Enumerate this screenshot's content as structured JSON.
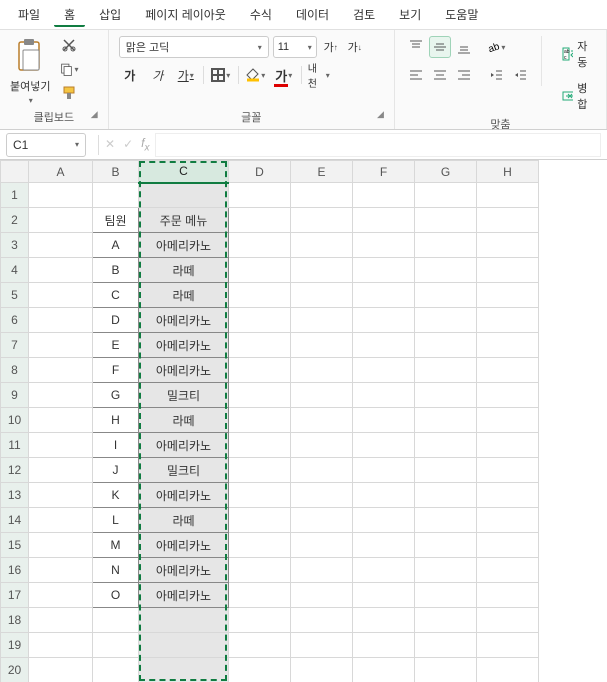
{
  "menu": {
    "items": [
      "파일",
      "홈",
      "삽입",
      "페이지 레이아웃",
      "수식",
      "데이터",
      "검토",
      "보기",
      "도움말"
    ],
    "active_index": 1
  },
  "ribbon": {
    "clipboard": {
      "paste_label": "붙여넣기",
      "group_label": "클립보드"
    },
    "font": {
      "name": "맑은 고딕",
      "size": "11",
      "group_label": "글꼴",
      "bold": "가",
      "italic": "가",
      "underline": "가",
      "grow": "가",
      "shrink": "가"
    },
    "align": {
      "group_label": "맞춤",
      "vert_label": "내천",
      "wrap_label": "자동",
      "merge_label": "병합"
    }
  },
  "namebox": {
    "value": "C1"
  },
  "columns": [
    "A",
    "B",
    "C",
    "D",
    "E",
    "F",
    "G",
    "H"
  ],
  "row_count": 20,
  "headers": {
    "B": "팀원",
    "C": "주문 메뉴"
  },
  "rows": [
    {
      "b": "A",
      "c": "아메리카노"
    },
    {
      "b": "B",
      "c": "라떼"
    },
    {
      "b": "C",
      "c": "라떼"
    },
    {
      "b": "D",
      "c": "아메리카노"
    },
    {
      "b": "E",
      "c": "아메리카노"
    },
    {
      "b": "F",
      "c": "아메리카노"
    },
    {
      "b": "G",
      "c": "밀크티"
    },
    {
      "b": "H",
      "c": "라떼"
    },
    {
      "b": "I",
      "c": "아메리카노"
    },
    {
      "b": "J",
      "c": "밀크티"
    },
    {
      "b": "K",
      "c": "아메리카노"
    },
    {
      "b": "L",
      "c": "라떼"
    },
    {
      "b": "M",
      "c": "아메리카노"
    },
    {
      "b": "N",
      "c": "아메리카노"
    },
    {
      "b": "O",
      "c": "아메리카노"
    }
  ],
  "selected_column": "C"
}
